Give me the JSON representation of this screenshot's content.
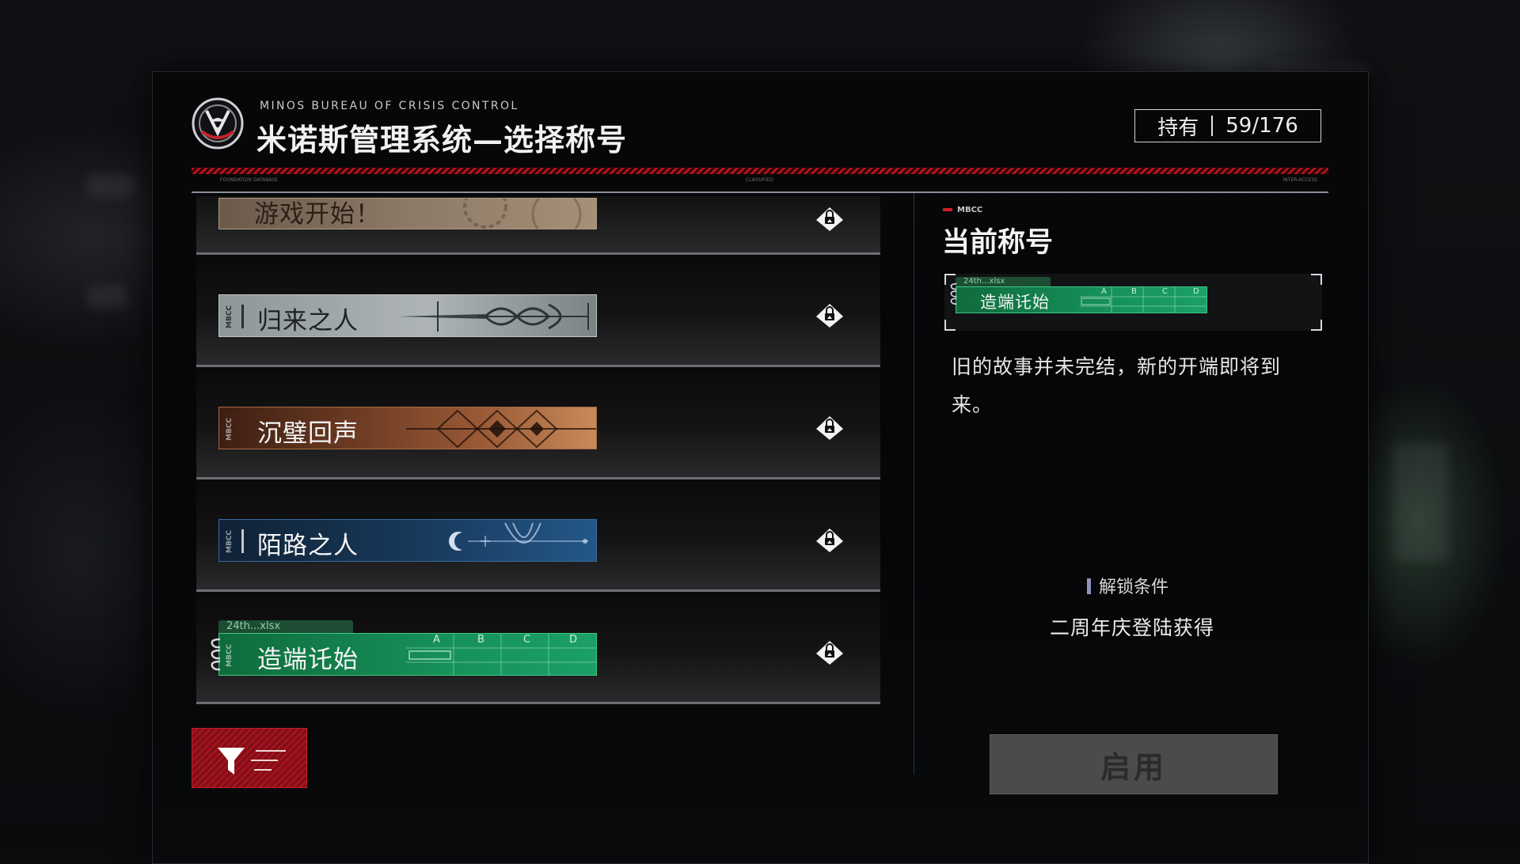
{
  "header": {
    "subtitle_en": "MINOS BUREAU OF CRISIS CONTROL",
    "title_cn": "米诺斯管理系统—选择称号",
    "owned_label": "持有",
    "owned_count": "59/176",
    "stripe_left": "FOUNDATION DATABASE",
    "stripe_center": "CLASSIFIED",
    "stripe_right": "INTER-ACCESS"
  },
  "titles": [
    {
      "label": "游戏开始！",
      "style": "sepia",
      "tag": "",
      "locked": true
    },
    {
      "label": "归来之人",
      "style": "grey",
      "tag": "MBCC",
      "locked": true
    },
    {
      "label": "沉璧回声",
      "style": "copper",
      "tag": "MBCC",
      "locked": true
    },
    {
      "label": "陌路之人",
      "style": "blue",
      "tag": "MBCC",
      "locked": true
    },
    {
      "label": "造端讬始",
      "style": "green",
      "tag": "MBCC",
      "locked": true,
      "file_tab": "24th...xlsx",
      "columns": [
        "A",
        "B",
        "C",
        "D"
      ]
    }
  ],
  "current": {
    "tag": "MBCC",
    "heading": "当前称号",
    "title_label": "造端讬始",
    "file_tab": "24th...xlsx",
    "columns": [
      "A",
      "B",
      "C",
      "D"
    ],
    "description": "旧的故事并未完结，新的开端即将到来。",
    "unlock_heading": "解锁条件",
    "unlock_text": "二周年庆登陆获得",
    "enable_button": "启用"
  },
  "colors": {
    "accent_red": "#b3121c",
    "title_green": "#16915a",
    "title_blue": "#183a5c",
    "title_copper": "#9a5a36",
    "title_grey": "#aeb4b7"
  },
  "icons": {
    "lock": "lock-icon",
    "filter": "filter-icon",
    "logo": "mbcc-emblem-icon"
  }
}
